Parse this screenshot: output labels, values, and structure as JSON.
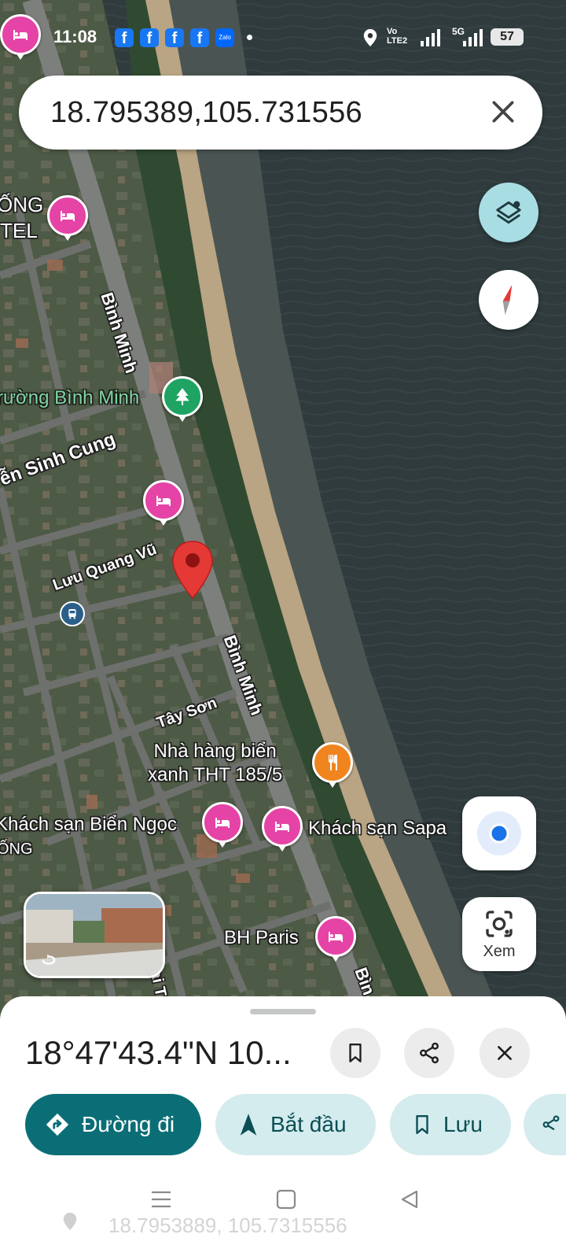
{
  "status_bar": {
    "time": "11:08",
    "notification_icons": [
      "f",
      "f",
      "f",
      "f"
    ],
    "zalo_label": "Zalo",
    "network_labels": [
      "Vo",
      "LTE2",
      "5G"
    ],
    "battery": "57"
  },
  "search": {
    "query": "18.795389,105.731556"
  },
  "map": {
    "roads": [
      "Bình Minh",
      "Bình Minh",
      "Lưu Quang Vũ",
      "Tây Sơn",
      "ễn Sinh Cung",
      "Bìn",
      "hai T"
    ],
    "park_label": "rường Bình Minh",
    "top_left_labels": [
      "ỐNG",
      "TEL"
    ],
    "places": {
      "restaurant": "Nhà hàng biển\nxanh THT 185/5",
      "hotel_bien_ngoc": "Khách sạn Biển Ngọc",
      "hotel_bien_ngoc_sub": "ỐNG",
      "hotel_sapa": "Khách sạn Sapa",
      "hotel_bh_paris": "BH Paris"
    }
  },
  "controls": {
    "lens_label": "Xem"
  },
  "sheet": {
    "coordinates": "18°47'43.4\"N 10...",
    "chips": {
      "directions": "Đường đi",
      "start": "Bắt đầu",
      "save": "Lưu"
    },
    "faded_coords": "18.7953889, 105.7315556"
  },
  "colors": {
    "hotel_pin": "#e543a6",
    "park_pin": "#1ea362",
    "restaurant_pin": "#f0851f",
    "primary": "#0b6e76",
    "chip_bg": "#d5ecee",
    "location_blue": "#1a73e8",
    "dropped_pin": "#e53935"
  },
  "icons": [
    "bed-icon",
    "tree-icon",
    "fork-knife-icon",
    "bus-icon",
    "layers-icon",
    "compass-icon",
    "my-location-icon",
    "camera-lens-icon",
    "bookmark-icon",
    "share-icon",
    "close-icon",
    "directions-icon",
    "navigation-arrow-icon",
    "menu-icon",
    "square-icon",
    "back-icon"
  ]
}
